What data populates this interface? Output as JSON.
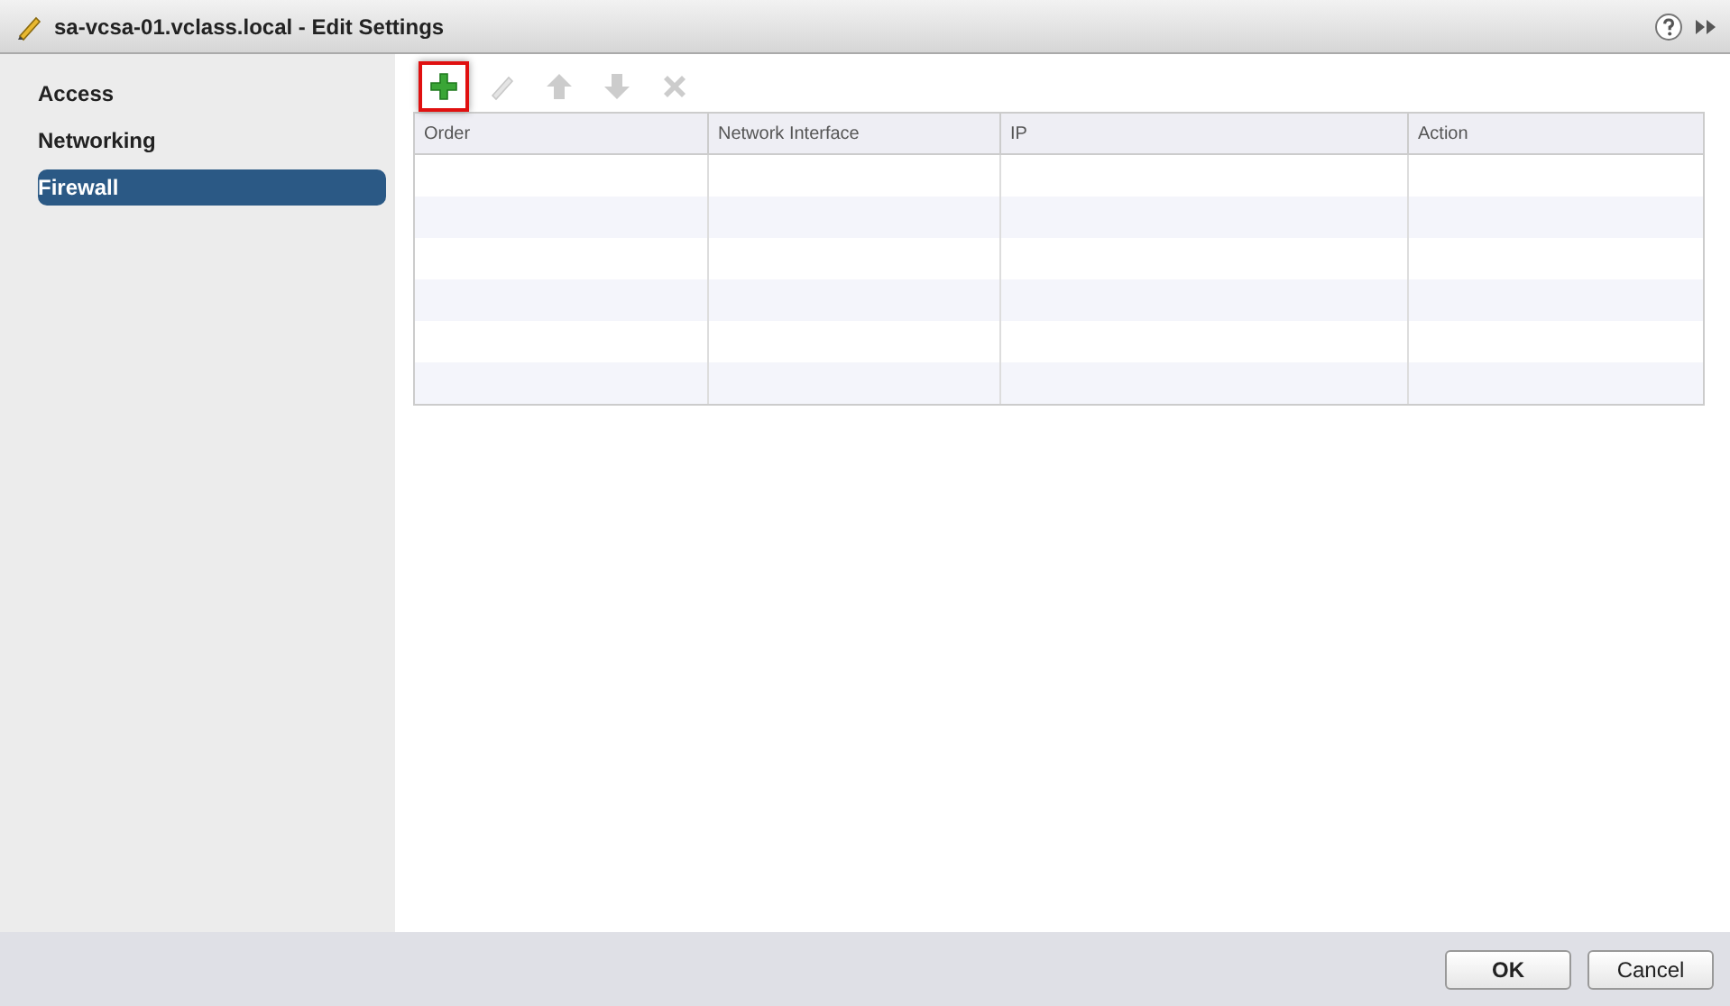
{
  "window": {
    "title": "sa-vcsa-01.vclass.local - Edit Settings"
  },
  "sidebar": {
    "items": [
      {
        "label": "Access",
        "selected": false
      },
      {
        "label": "Networking",
        "selected": false
      },
      {
        "label": "Firewall",
        "selected": true
      }
    ]
  },
  "toolbar": [
    {
      "kind": "add",
      "disabled": false,
      "highlighted": true
    },
    {
      "kind": "edit",
      "disabled": true,
      "highlighted": false
    },
    {
      "kind": "up",
      "disabled": true,
      "highlighted": false
    },
    {
      "kind": "down",
      "disabled": true,
      "highlighted": false
    },
    {
      "kind": "delete",
      "disabled": true,
      "highlighted": false
    }
  ],
  "table": {
    "columns": [
      "Order",
      "Network Interface",
      "IP",
      "Action"
    ]
  },
  "buttons": [
    {
      "label": "OK",
      "default": true
    },
    {
      "label": "Cancel",
      "default": false
    }
  ]
}
